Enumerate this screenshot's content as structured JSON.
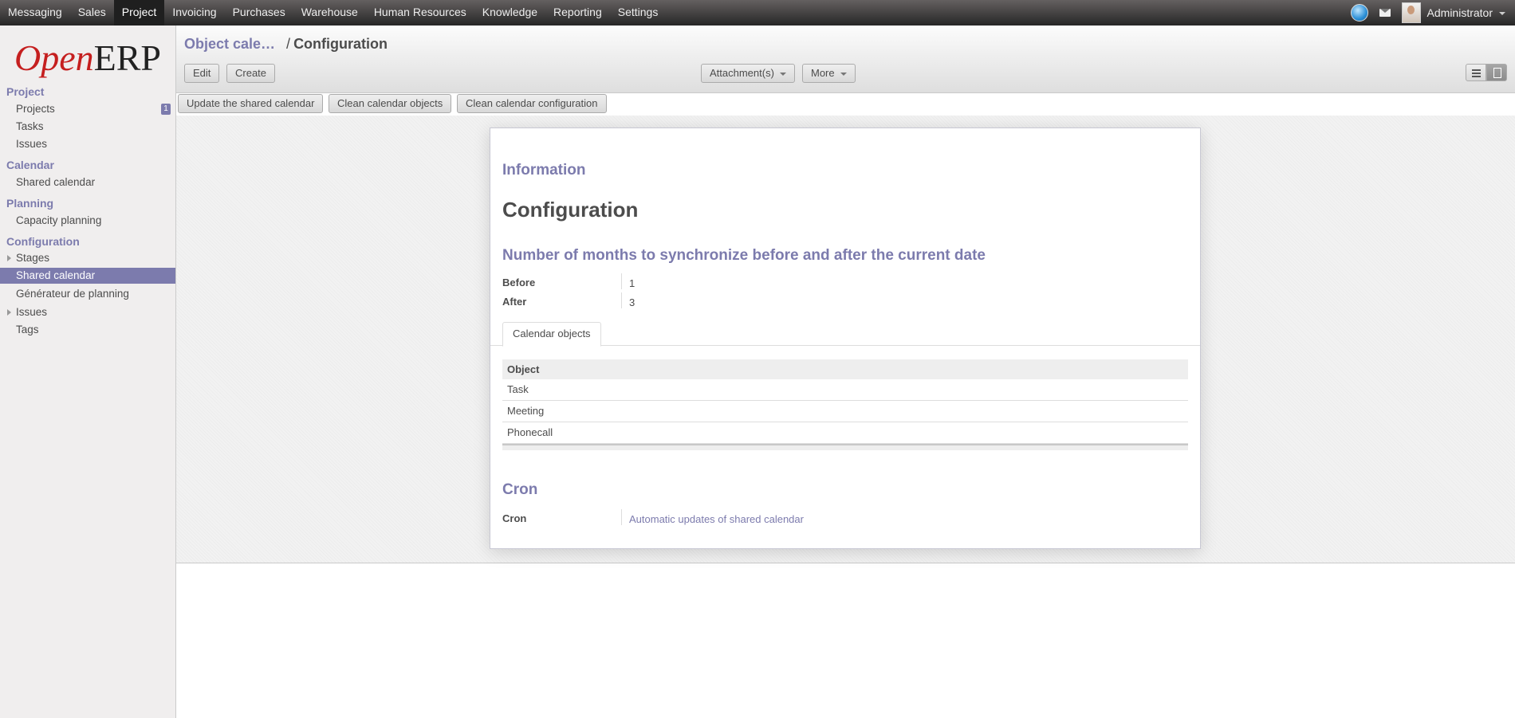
{
  "topmenu": [
    "Messaging",
    "Sales",
    "Project",
    "Invoicing",
    "Purchases",
    "Warehouse",
    "Human Resources",
    "Knowledge",
    "Reporting",
    "Settings"
  ],
  "user": {
    "name": "Administrator"
  },
  "logo": {
    "open": "Open",
    "erp": "ERP"
  },
  "sidebar": {
    "sec_project": "Project",
    "projects": "Projects",
    "projects_badge": "1",
    "tasks": "Tasks",
    "issues": "Issues",
    "sec_calendar": "Calendar",
    "shared_calendar": "Shared calendar",
    "sec_planning": "Planning",
    "capacity_planning": "Capacity planning",
    "sec_configuration": "Configuration",
    "stages": "Stages",
    "shared_calendar_cfg": "Shared calendar",
    "generateur": "Générateur de planning",
    "issues_cfg": "Issues",
    "tags": "Tags"
  },
  "breadcrumb": {
    "parent": "Object cale…",
    "sep": "/",
    "current": "Configuration"
  },
  "toolbar": {
    "edit": "Edit",
    "create": "Create",
    "attachments": "Attachment(s)",
    "more": "More"
  },
  "actions": {
    "update": "Update the shared calendar",
    "clean_objects": "Clean calendar objects",
    "clean_config": "Clean calendar configuration"
  },
  "form": {
    "info_heading": "Information",
    "title": "Configuration",
    "months_heading": "Number of months to synchronize before and after the current date",
    "before_label": "Before",
    "before_value": "1",
    "after_label": "After",
    "after_value": "3",
    "tab_label": "Calendar objects",
    "table_header": "Object",
    "rows": [
      "Task",
      "Meeting",
      "Phonecall"
    ],
    "cron_heading": "Cron",
    "cron_label": "Cron",
    "cron_value": "Automatic updates of shared calendar"
  }
}
